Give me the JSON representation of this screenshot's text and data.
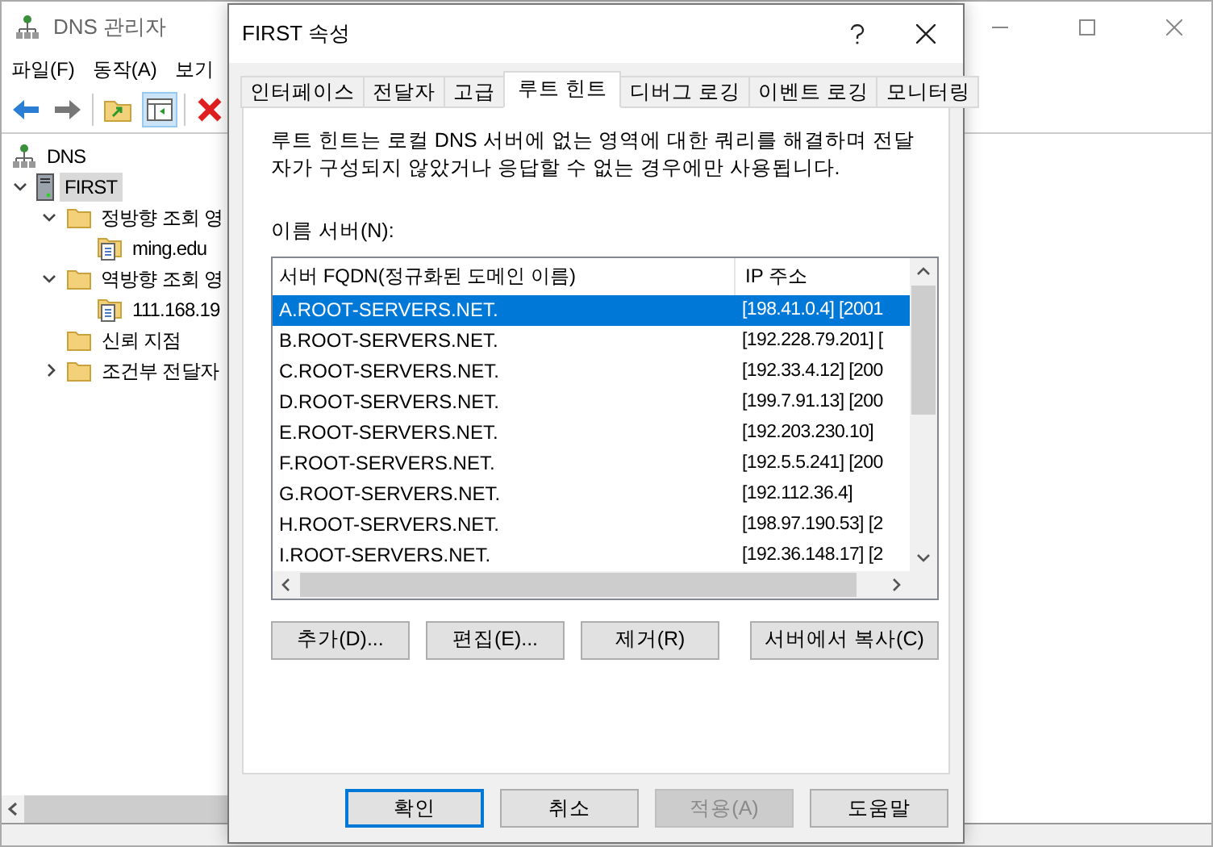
{
  "main_window": {
    "title": "DNS 관리자",
    "menu": [
      "파일(F)",
      "동작(A)",
      "보기"
    ],
    "tree": [
      {
        "label": "DNS",
        "kind": "root",
        "selected": false,
        "children": [
          {
            "label": "FIRST",
            "kind": "server",
            "selected": true,
            "expanded": true,
            "children": [
              {
                "label": "정방향 조회 영",
                "kind": "folder",
                "selected": false,
                "expanded": true,
                "children": [
                  {
                    "label": "ming.edu",
                    "kind": "zone",
                    "selected": false
                  }
                ]
              },
              {
                "label": "역방향 조회 영",
                "kind": "folder",
                "selected": false,
                "expanded": true,
                "children": [
                  {
                    "label": "111.168.19",
                    "kind": "zone",
                    "selected": false
                  }
                ]
              },
              {
                "label": "신뢰 지점",
                "kind": "folder",
                "selected": false
              },
              {
                "label": "조건부 전달자",
                "kind": "folder",
                "selected": false,
                "expanded": false
              }
            ]
          }
        ]
      }
    ]
  },
  "dialog": {
    "title": "FIRST 속성",
    "tabs": [
      {
        "label": "인터페이스",
        "selected": false
      },
      {
        "label": "전달자",
        "selected": false
      },
      {
        "label": "고급",
        "selected": false
      },
      {
        "label": "루트 힌트",
        "selected": true
      },
      {
        "label": "디버그 로깅",
        "selected": false
      },
      {
        "label": "이벤트 로깅",
        "selected": false
      },
      {
        "label": "모니터링",
        "selected": false
      }
    ],
    "description": "루트 힌트는 로컬 DNS 서버에 없는 영역에 대한 쿼리를 해결하며 전달자가 구성되지 않았거나 응답할 수 없는 경우에만 사용됩니다.",
    "list_label": "이름 서버(N):",
    "table": {
      "columns": [
        "서버 FQDN(정규화된 도메인 이름)",
        "IP 주소"
      ],
      "rows": [
        {
          "fqdn": "A.ROOT-SERVERS.NET.",
          "ip": "[198.41.0.4] [2001",
          "selected": true
        },
        {
          "fqdn": "B.ROOT-SERVERS.NET.",
          "ip": "[192.228.79.201] [",
          "selected": false
        },
        {
          "fqdn": "C.ROOT-SERVERS.NET.",
          "ip": "[192.33.4.12] [200",
          "selected": false
        },
        {
          "fqdn": "D.ROOT-SERVERS.NET.",
          "ip": "[199.7.91.13] [200",
          "selected": false
        },
        {
          "fqdn": "E.ROOT-SERVERS.NET.",
          "ip": "[192.203.230.10]",
          "selected": false
        },
        {
          "fqdn": "F.ROOT-SERVERS.NET.",
          "ip": "[192.5.5.241] [200",
          "selected": false
        },
        {
          "fqdn": "G.ROOT-SERVERS.NET.",
          "ip": "[192.112.36.4]",
          "selected": false
        },
        {
          "fqdn": "H.ROOT-SERVERS.NET.",
          "ip": "[198.97.190.53] [2",
          "selected": false
        },
        {
          "fqdn": "I.ROOT-SERVERS.NET.",
          "ip": "[192.36.148.17] [2",
          "selected": false
        }
      ]
    },
    "list_buttons": [
      "추가(D)...",
      "편집(E)...",
      "제거(R)",
      "서버에서 복사(C)"
    ],
    "footer_buttons": [
      {
        "label": "확인",
        "default": true,
        "disabled": false
      },
      {
        "label": "취소",
        "default": false,
        "disabled": false
      },
      {
        "label": "적용(A)",
        "disabled": true
      },
      {
        "label": "도움말",
        "default": false,
        "disabled": false
      }
    ]
  }
}
